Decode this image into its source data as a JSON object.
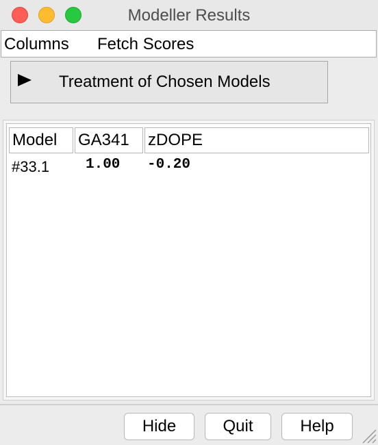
{
  "window": {
    "title": "Modeller Results"
  },
  "menu": {
    "columns": "Columns",
    "fetch_scores": "Fetch Scores"
  },
  "treatment": {
    "label": "Treatment of Chosen Models"
  },
  "table": {
    "headers": [
      "Model",
      "GA341",
      "zDOPE"
    ],
    "rows": [
      {
        "model": "#33.1",
        "ga341": "1.00",
        "zdope": "-0.20"
      }
    ]
  },
  "buttons": {
    "hide": "Hide",
    "quit": "Quit",
    "help": "Help"
  },
  "colors": {
    "close": "#fd5f57",
    "minimize": "#fdbc2e",
    "maximize": "#28c840"
  }
}
